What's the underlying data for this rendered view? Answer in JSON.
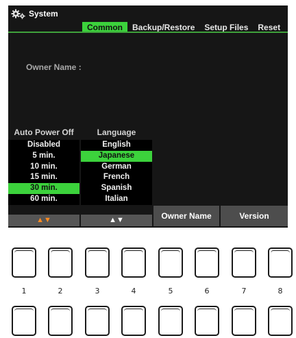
{
  "window": {
    "title": "System"
  },
  "tabs": [
    "Common",
    "Backup/Restore",
    "Setup Files",
    "Reset"
  ],
  "owner": {
    "label": "Owner Name :"
  },
  "auto_power_off": {
    "header": "Auto Power Off",
    "items": [
      "Disabled",
      "5 min.",
      "10 min.",
      "15 min.",
      "30 min.",
      "60 min."
    ],
    "selected": "30 min.",
    "arrows": "▲▼"
  },
  "language": {
    "header": "Language",
    "items": [
      "English",
      "Japanese",
      "German",
      "French",
      "Spanish",
      "Italian"
    ],
    "selected": "Japanese",
    "arrows": "▲▼"
  },
  "buttons": {
    "owner_name": "Owner Name",
    "version": "Version"
  },
  "hardware_buttons": [
    "1",
    "2",
    "3",
    "4",
    "5",
    "6",
    "7",
    "8"
  ],
  "colors": {
    "accent": "#3cd23c",
    "background": "#161616",
    "orange_arrows": "#ff8a1e"
  },
  "icons": {
    "title_icon": "gear-icon"
  }
}
